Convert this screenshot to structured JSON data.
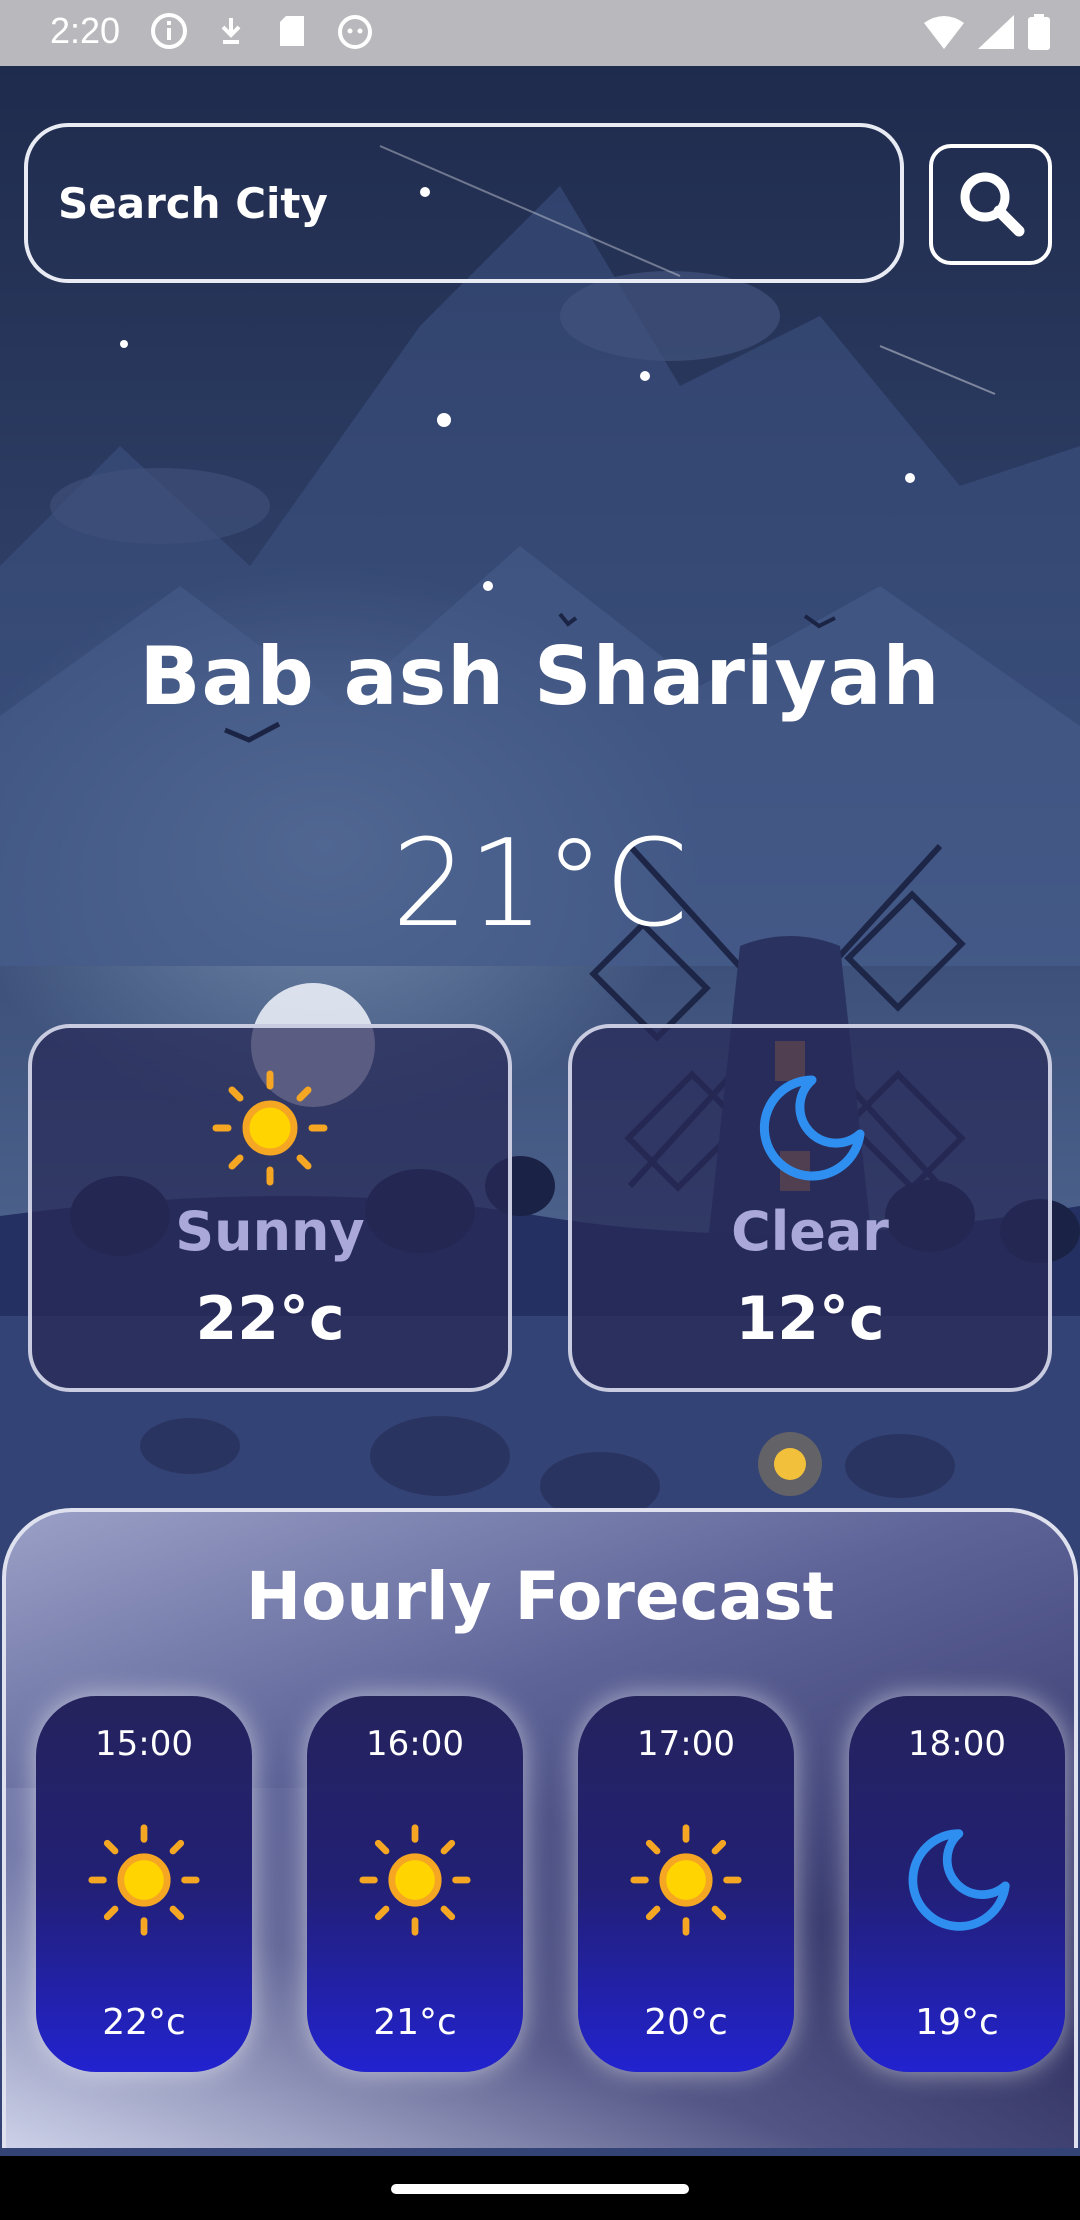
{
  "status_bar": {
    "time": "2:20",
    "left_icons": [
      "info-icon",
      "download-icon",
      "sd-card-icon",
      "android-icon"
    ],
    "right_icons": [
      "wifi-icon",
      "signal-icon",
      "battery-icon"
    ]
  },
  "search": {
    "placeholder": "Search City",
    "button_icon": "search-icon"
  },
  "location": {
    "city": "Bab ash Shariyah",
    "temperature": "21°C"
  },
  "summary_cards": [
    {
      "condition": "Sunny",
      "temperature": "22°c",
      "icon": "sun-icon"
    },
    {
      "condition": "Clear",
      "temperature": "12°c",
      "icon": "moon-icon"
    }
  ],
  "hourly": {
    "title": "Hourly Forecast",
    "items": [
      {
        "time": "15:00",
        "temperature": "22°c",
        "icon": "sun-icon"
      },
      {
        "time": "16:00",
        "temperature": "21°c",
        "icon": "sun-icon"
      },
      {
        "time": "17:00",
        "temperature": "20°c",
        "icon": "sun-icon"
      },
      {
        "time": "18:00",
        "temperature": "19°c",
        "icon": "moon-icon"
      }
    ]
  },
  "colors": {
    "sun": "#f5a623",
    "sun_core": "#ffd400",
    "moon": "#2f8ff0",
    "card_border": "#c9cbe0",
    "condition_text": "#a9a8d8"
  }
}
